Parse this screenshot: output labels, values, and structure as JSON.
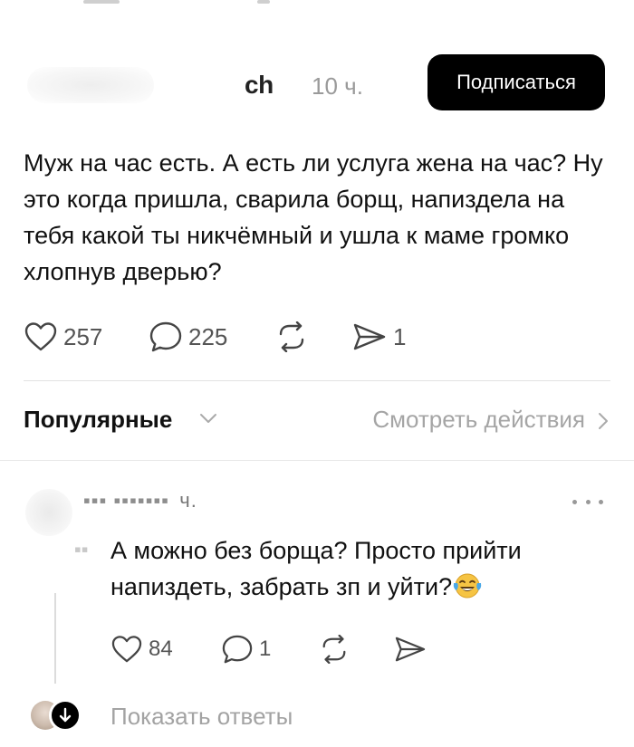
{
  "post": {
    "username": "ch",
    "time": "10 ч.",
    "subscribe_label": "Подписаться",
    "text": "Муж на час есть. А есть ли услуга жена на час? Ну это когда пришла, сварила борщ, напиздела на тебя какой ты никчёмный и ушла к маме громко хлопнув дверью?",
    "likes": "257",
    "comments": "225",
    "shares": "1"
  },
  "sort": {
    "label": "Популярные",
    "activity_label": "Смотреть действия"
  },
  "comment": {
    "time": "ч.",
    "text": "А можно без борща? Просто прийти напиздеть, забрать зп и уйти?",
    "likes": "84",
    "replies": "1"
  },
  "replies": {
    "show_label": "Показать ответы"
  },
  "icons": {
    "heart": "heart-icon",
    "comment": "comment-icon",
    "repost": "repost-icon",
    "share": "share-icon",
    "more": "more-icon",
    "chevron": "chevron-down-icon",
    "arrow_down": "arrow-down-icon"
  },
  "colors": {
    "subscribe_bg": "#000000",
    "muted_text": "#9a9a9a"
  }
}
